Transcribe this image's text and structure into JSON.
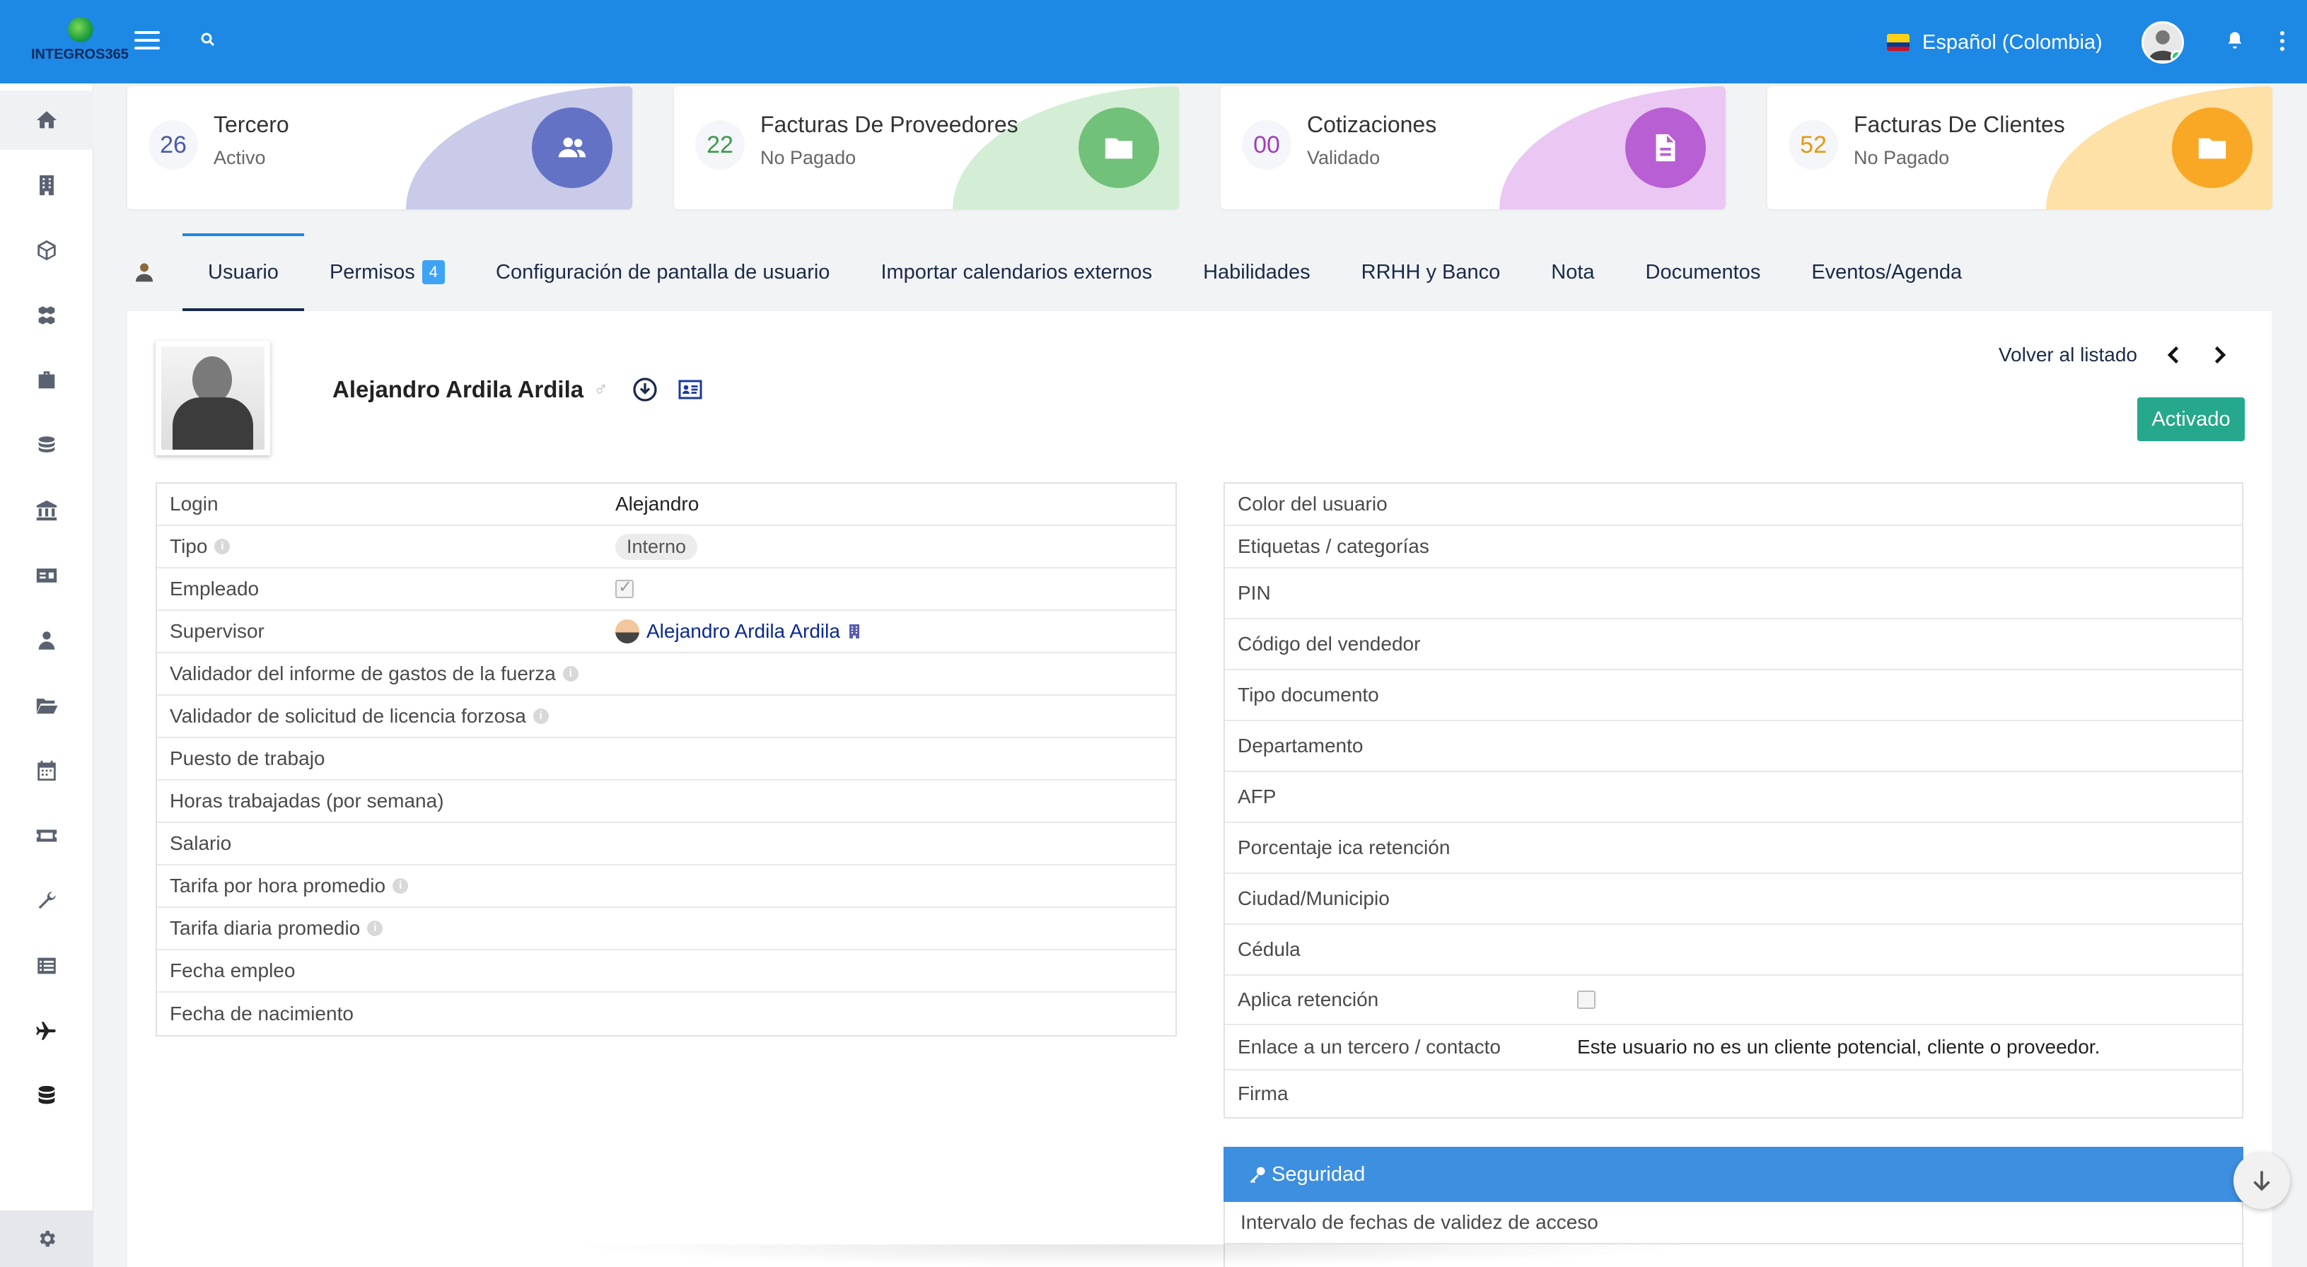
{
  "header": {
    "logo_text": "INTEGROS365",
    "language": "Español (Colombia)"
  },
  "cards": [
    {
      "count": "26",
      "title": "Tercero",
      "status": "Activo",
      "color": "#6472c6",
      "blob": "#c9cbe9",
      "num_color": "#4a5aa6",
      "icon": "users-icon"
    },
    {
      "count": "22",
      "title": "Facturas De Proveedores",
      "status": "No Pagado",
      "color": "#72c17a",
      "blob": "#d3eed5",
      "num_color": "#3d9a49",
      "icon": "folder-icon"
    },
    {
      "count": "00",
      "title": "Cotizaciones",
      "status": "Validado",
      "color": "#b85fd3",
      "blob": "#eac8f3",
      "num_color": "#a13dbf",
      "icon": "document-icon"
    },
    {
      "count": "52",
      "title": "Facturas De Clientes",
      "status": "No Pagado",
      "color": "#f9a825",
      "blob": "#fde1a6",
      "num_color": "#e39a10",
      "icon": "folder-icon"
    }
  ],
  "tabs": [
    {
      "label": "Usuario",
      "active": true
    },
    {
      "label": "Permisos",
      "badge": "4"
    },
    {
      "label": "Configuración de pantalla de usuario"
    },
    {
      "label": "Importar calendarios externos"
    },
    {
      "label": "Habilidades"
    },
    {
      "label": "RRHH y Banco"
    },
    {
      "label": "Nota"
    },
    {
      "label": "Documentos"
    },
    {
      "label": "Eventos/Agenda"
    }
  ],
  "user": {
    "name": "Alejandro Ardila Ardila",
    "gender_symbol": "♂",
    "back_link": "Volver al listado",
    "status_button": "Activado"
  },
  "left_fields": [
    {
      "label": "Login",
      "value": "Alejandro"
    },
    {
      "label": "Tipo",
      "value": "Interno",
      "info": true
    },
    {
      "label": "Empleado",
      "value": ""
    },
    {
      "label": "Supervisor",
      "value": "Alejandro Ardila Ardila"
    },
    {
      "label": "Validador del informe de gastos de la fuerza",
      "value": "",
      "info": true
    },
    {
      "label": "Validador de solicitud de licencia forzosa",
      "value": "",
      "info": true
    },
    {
      "label": "Puesto de trabajo",
      "value": ""
    },
    {
      "label": "Horas trabajadas (por semana)",
      "value": ""
    },
    {
      "label": "Salario",
      "value": ""
    },
    {
      "label": "Tarifa por hora promedio",
      "value": "",
      "info": true
    },
    {
      "label": "Tarifa diaria promedio",
      "value": "",
      "info": true
    },
    {
      "label": "Fecha empleo",
      "value": ""
    },
    {
      "label": "Fecha de nacimiento",
      "value": ""
    }
  ],
  "right_fields": [
    {
      "label": "Color del usuario",
      "value": ""
    },
    {
      "label": "Etiquetas / categorías",
      "value": ""
    },
    {
      "label": "PIN",
      "value": ""
    },
    {
      "label": "Código del vendedor",
      "value": ""
    },
    {
      "label": "Tipo documento",
      "value": ""
    },
    {
      "label": "Departamento",
      "value": ""
    },
    {
      "label": "AFP",
      "value": ""
    },
    {
      "label": "Porcentaje ica retención",
      "value": ""
    },
    {
      "label": "Ciudad/Municipio",
      "value": ""
    },
    {
      "label": "Cédula",
      "value": ""
    },
    {
      "label": "Aplica retención",
      "value": ""
    },
    {
      "label": "Enlace a un tercero / contacto",
      "value": "Este usuario no es un cliente potencial, cliente o proveedor."
    },
    {
      "label": "Firma",
      "value": ""
    }
  ],
  "security": {
    "title": "Seguridad",
    "row1": "Intervalo de fechas de validez de acceso"
  },
  "colors": {
    "topbar": "#1e88e5",
    "active_button": "#25a88c",
    "section_head": "#3d8fe0"
  }
}
